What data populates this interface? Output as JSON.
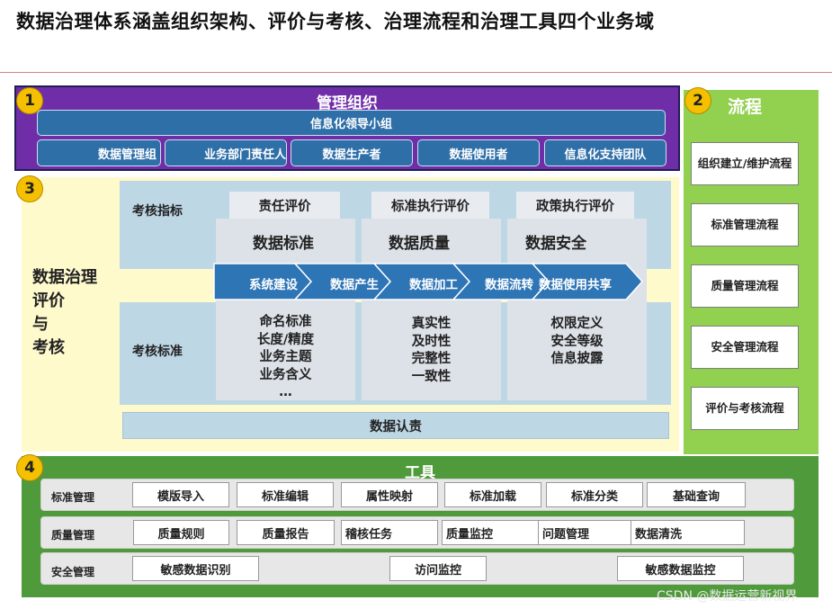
{
  "title": "数据治理体系涵盖组织架构、评价与考核、治理流程和治理工具四个业务域",
  "badges": [
    "1",
    "2",
    "3",
    "4"
  ],
  "organization": {
    "title": "管理组织",
    "leader": "信息化领导小组",
    "members": [
      "数据管理组",
      "业务部门责任人",
      "数据生产者",
      "数据使用者",
      "信息化支持团队"
    ]
  },
  "process": {
    "title": "流程",
    "items": [
      "组织建立/维护流程",
      "标准管理流程",
      "质量管理流程",
      "安全管理流程",
      "评价与考核流程"
    ]
  },
  "evaluation": {
    "label_lines": [
      "数据治理",
      "评价",
      "与",
      "考核"
    ],
    "indicators_label": "考核指标",
    "standards_label": "考核标准",
    "tabs": [
      "责任评价",
      "标准执行评价",
      "政策执行评价"
    ],
    "areas": [
      "数据标准",
      "数据质量",
      "数据安全"
    ],
    "flow": [
      "系统建设",
      "数据产生",
      "数据加工",
      "数据流转",
      "数据使用共享"
    ],
    "criteria": [
      [
        "命名标准",
        "长度/精度",
        "业务主题",
        "业务含义",
        "…"
      ],
      [
        "真实性",
        "及时性",
        "完整性",
        "一致性"
      ],
      [
        "权限定义",
        "安全等级",
        "信息披露"
      ]
    ],
    "accountability": "数据认责"
  },
  "tools": {
    "title": "工具",
    "rows": [
      {
        "label": "标准管理",
        "items": [
          "模版导入",
          "标准编辑",
          "属性映射",
          "标准加载",
          "标准分类",
          "基础查询"
        ]
      },
      {
        "label": "质量管理",
        "items": [
          "质量规则",
          "质量报告",
          "稽核任务",
          "质量监控",
          "问题管理",
          "数据清洗"
        ]
      },
      {
        "label": "安全管理",
        "items": [
          "敏感数据识别",
          "访问监控",
          "敏感数据监控"
        ]
      }
    ]
  },
  "watermark": "CSDN @数据运营新视界",
  "colors": {
    "org": "#6f2da8",
    "process": "#92d050",
    "eval_bg": "#fffacc",
    "tools": "#4f9a3a",
    "badge": "#f5c000",
    "arrow": "#2e75b6"
  }
}
